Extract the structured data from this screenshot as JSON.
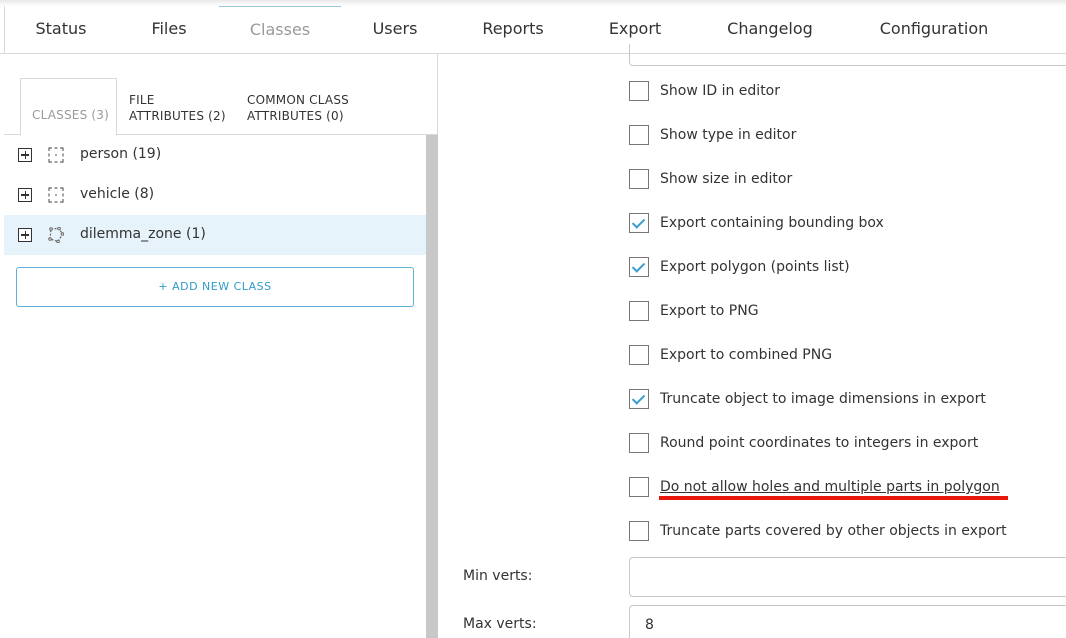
{
  "top_tabs": [
    {
      "label": "Status"
    },
    {
      "label": "Files"
    },
    {
      "label": "Classes"
    },
    {
      "label": "Users"
    },
    {
      "label": "Reports"
    },
    {
      "label": "Export"
    },
    {
      "label": "Changelog"
    },
    {
      "label": "Configuration"
    }
  ],
  "active_tab": "Classes",
  "sub_tabs": [
    {
      "label": "CLASSES (3)"
    },
    {
      "line1": "FILE",
      "line2": "ATTRIBUTES (2)"
    },
    {
      "line1": "COMMON CLASS",
      "line2": "ATTRIBUTES (0)"
    }
  ],
  "classes": [
    {
      "label": "person (19)",
      "icon": "bounding-box-icon"
    },
    {
      "label": "vehicle (8)",
      "icon": "bounding-box-icon"
    },
    {
      "label": "dilemma_zone (1)",
      "icon": "polygon-icon",
      "selected": true
    }
  ],
  "add_class_label": "+ ADD NEW CLASS",
  "options": [
    {
      "label": "Show ID in editor",
      "checked": false
    },
    {
      "label": "Show type in editor",
      "checked": false
    },
    {
      "label": "Show size in editor",
      "checked": false
    },
    {
      "label": "Export containing bounding box",
      "checked": true
    },
    {
      "label": "Export polygon (points list)",
      "checked": true
    },
    {
      "label": "Export to PNG",
      "checked": false
    },
    {
      "label": "Export to combined PNG",
      "checked": false
    },
    {
      "label": "Truncate object to image dimensions in export",
      "checked": true
    },
    {
      "label": "Round point coordinates to integers in export",
      "checked": false
    },
    {
      "label": "Do not allow holes and multiple parts in polygon",
      "checked": false
    },
    {
      "label": "Truncate parts covered by other objects in export",
      "checked": false
    }
  ],
  "fields": {
    "min_verts_label": "Min verts:",
    "min_verts_value": "",
    "max_verts_label": "Max verts:",
    "max_verts_value": "8"
  },
  "colors": {
    "accent": "#2f9bc8",
    "check": "#3a9fd0",
    "selected_row": "#e6f3fa",
    "highlight_underline": "#e8180c"
  }
}
